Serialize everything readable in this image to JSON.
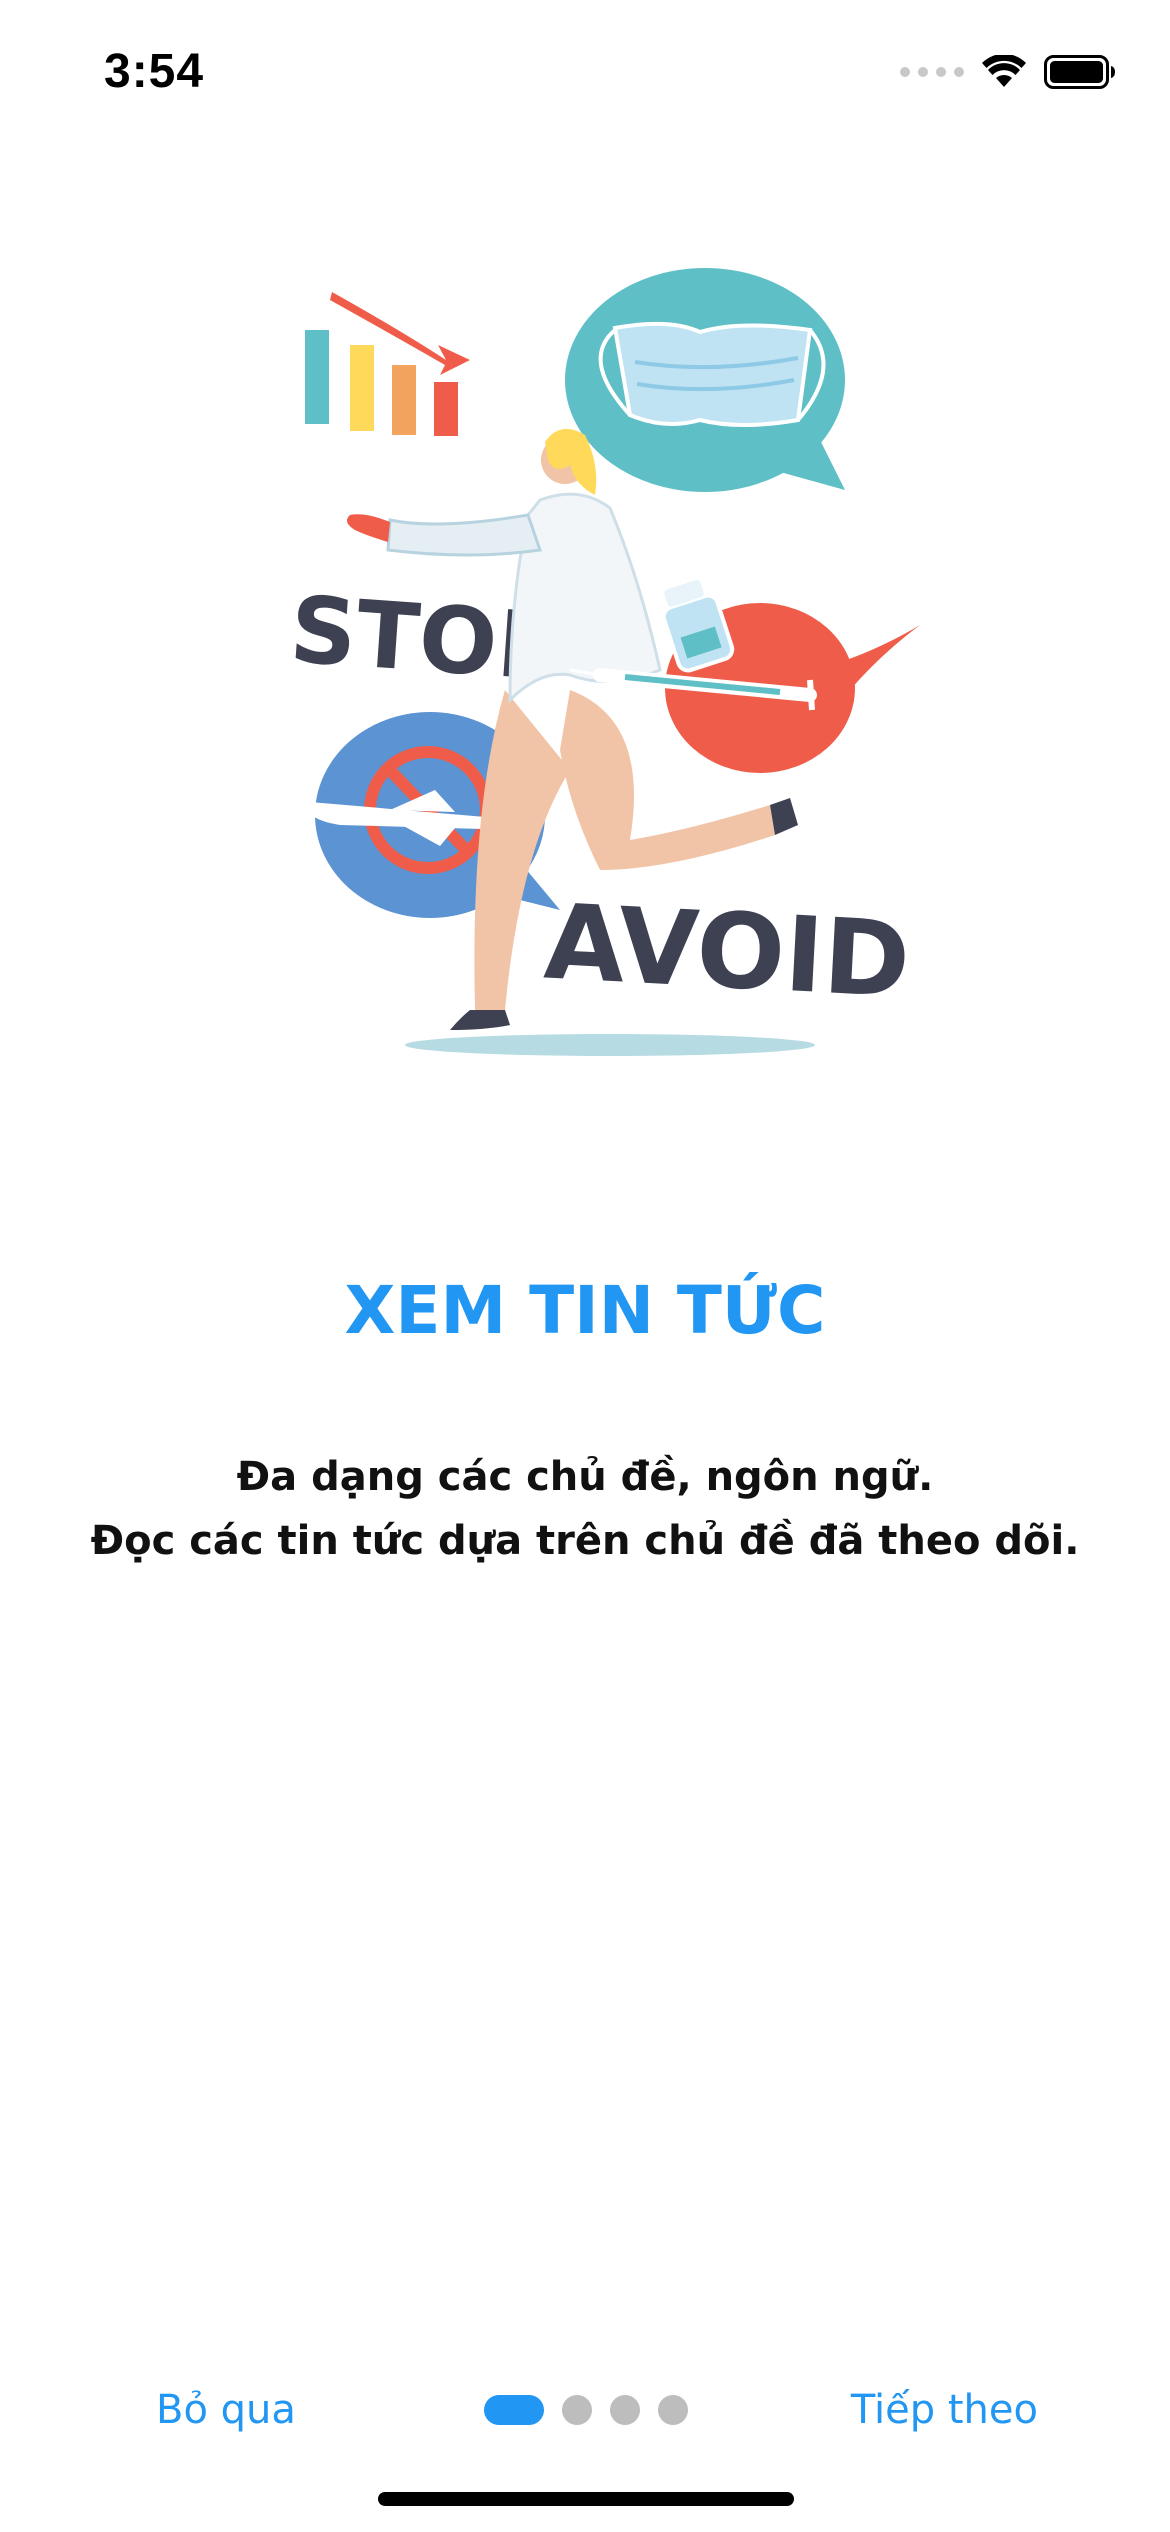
{
  "status_bar": {
    "time": "3:54",
    "icons": [
      "cellular-signal-icon",
      "wifi-icon",
      "battery-icon"
    ]
  },
  "illustration": {
    "stop_text": "STOP",
    "avoid_text": "AVOID",
    "colors": {
      "teal": "#5fbfc6",
      "coral": "#ef5d4a",
      "blue": "#5b93d3",
      "dark": "#3d4152",
      "skin": "#f1c3a7"
    }
  },
  "onboarding": {
    "title": "XEM TIN TỨC",
    "description_lines": [
      "Đa dạng các chủ đề, ngôn ngữ.",
      "Đọc các tin tức dựa trên chủ đề đã theo dõi."
    ],
    "page_current": 1,
    "page_total": 4
  },
  "bottom_nav": {
    "skip_label": "Bỏ qua",
    "next_label": "Tiếp theo"
  },
  "colors": {
    "accent": "#2196f3",
    "dot_inactive": "#bdbdbd"
  }
}
